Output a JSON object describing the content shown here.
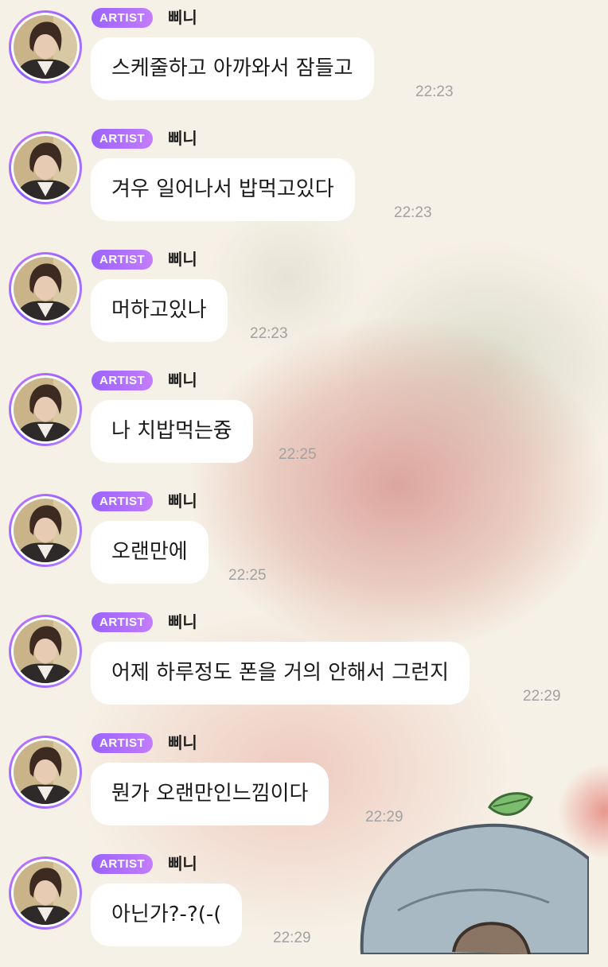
{
  "sender": {
    "badge": "ARTIST",
    "name": "삐니"
  },
  "messages": [
    {
      "text": "스케줄하고 아까와서 잠들고",
      "time": "22:23"
    },
    {
      "text": "겨우 일어나서 밥먹고있다",
      "time": "22:23"
    },
    {
      "text": "머하고있나",
      "time": "22:23"
    },
    {
      "text": "나 치밥먹는즁",
      "time": "22:25"
    },
    {
      "text": "오랜만에",
      "time": "22:25"
    },
    {
      "text": "어제 하루정도 폰을 거의 안해서 그런지",
      "time": "22:29"
    },
    {
      "text": "뭔가 오랜만인느낌이다",
      "time": "22:29"
    },
    {
      "text": "아닌가?-?(-(",
      "time": "22:29"
    }
  ],
  "icons": {
    "avatar": "artist-avatar-photo",
    "background": "character-illustration"
  }
}
